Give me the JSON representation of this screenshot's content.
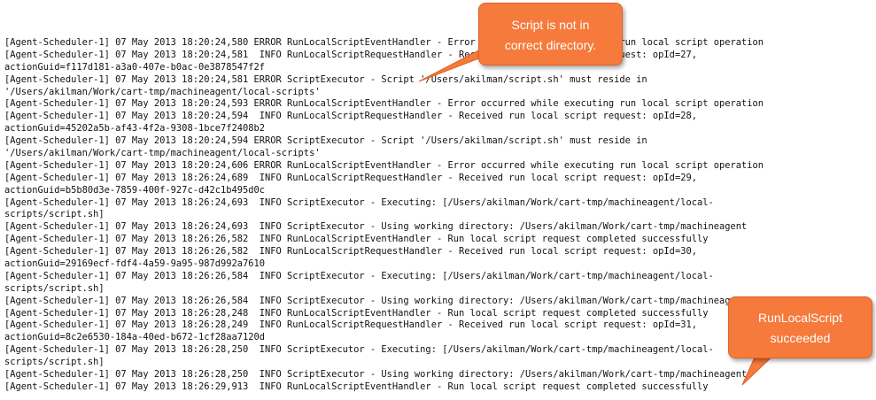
{
  "log_lines": [
    "[Agent-Scheduler-1] 07 May 2013 18:20:24,580 ERROR RunLocalScriptEventHandler - Error occurred while executing run local script operation",
    "[Agent-Scheduler-1] 07 May 2013 18:20:24,581  INFO RunLocalScriptRequestHandler - Received run local script request: opId=27,",
    "actionGuid=f117d181-a3a0-407e-b0ac-0e3878547f2f",
    "[Agent-Scheduler-1] 07 May 2013 18:20:24,581 ERROR ScriptExecutor - Script '/Users/akilman/script.sh' must reside in",
    "'/Users/akilman/Work/cart-tmp/machineagent/local-scripts'",
    "[Agent-Scheduler-1] 07 May 2013 18:20:24,593 ERROR RunLocalScriptEventHandler - Error occurred while executing run local script operation",
    "[Agent-Scheduler-1] 07 May 2013 18:20:24,594  INFO RunLocalScriptRequestHandler - Received run local script request: opId=28,",
    "actionGuid=45202a5b-af43-4f2a-9308-1bce7f2408b2",
    "[Agent-Scheduler-1] 07 May 2013 18:20:24,594 ERROR ScriptExecutor - Script '/Users/akilman/script.sh' must reside in",
    "'/Users/akilman/Work/cart-tmp/machineagent/local-scripts'",
    "[Agent-Scheduler-1] 07 May 2013 18:20:24,606 ERROR RunLocalScriptEventHandler - Error occurred while executing run local script operation",
    "[Agent-Scheduler-1] 07 May 2013 18:26:24,689  INFO RunLocalScriptRequestHandler - Received run local script request: opId=29,",
    "actionGuid=b5b80d3e-7859-400f-927c-d42c1b495d0c",
    "[Agent-Scheduler-1] 07 May 2013 18:26:24,693  INFO ScriptExecutor - Executing: [/Users/akilman/Work/cart-tmp/machineagent/local-",
    "scripts/script.sh]",
    "[Agent-Scheduler-1] 07 May 2013 18:26:24,693  INFO ScriptExecutor - Using working directory: /Users/akilman/Work/cart-tmp/machineagent",
    "[Agent-Scheduler-1] 07 May 2013 18:26:26,582  INFO RunLocalScriptEventHandler - Run local script request completed successfully",
    "[Agent-Scheduler-1] 07 May 2013 18:26:26,582  INFO RunLocalScriptRequestHandler - Received run local script request: opId=30,",
    "actionGuid=29169ecf-fdf4-4a59-9a95-987d992a7610",
    "[Agent-Scheduler-1] 07 May 2013 18:26:26,584  INFO ScriptExecutor - Executing: [/Users/akilman/Work/cart-tmp/machineagent/local-",
    "scripts/script.sh]",
    "[Agent-Scheduler-1] 07 May 2013 18:26:26,584  INFO ScriptExecutor - Using working directory: /Users/akilman/Work/cart-tmp/machineagent",
    "[Agent-Scheduler-1] 07 May 2013 18:26:28,248  INFO RunLocalScriptEventHandler - Run local script request completed successfully",
    "[Agent-Scheduler-1] 07 May 2013 18:26:28,249  INFO RunLocalScriptRequestHandler - Received run local script request: opId=31,",
    "actionGuid=8c2e6530-184a-40ed-b672-1cf28aa7120d",
    "[Agent-Scheduler-1] 07 May 2013 18:26:28,250  INFO ScriptExecutor - Executing: [/Users/akilman/Work/cart-tmp/machineagent/local-",
    "scripts/script.sh]",
    "[Agent-Scheduler-1] 07 May 2013 18:26:28,250  INFO ScriptExecutor - Using working directory: /Users/akilman/Work/cart-tmp/machineagent",
    "[Agent-Scheduler-1] 07 May 2013 18:26:29,913  INFO RunLocalScriptEventHandler - Run local script request completed successfully"
  ],
  "callouts": [
    {
      "line1": "Script is not in",
      "line2": "correct directory."
    },
    {
      "line1": "RunLocalScript",
      "line2": "succeeded"
    }
  ],
  "colors": {
    "callout_fill": "#f57a3c",
    "callout_border": "#e0622a",
    "callout_text": "#ffffff",
    "log_text": "#111111",
    "background": "#ffffff"
  }
}
